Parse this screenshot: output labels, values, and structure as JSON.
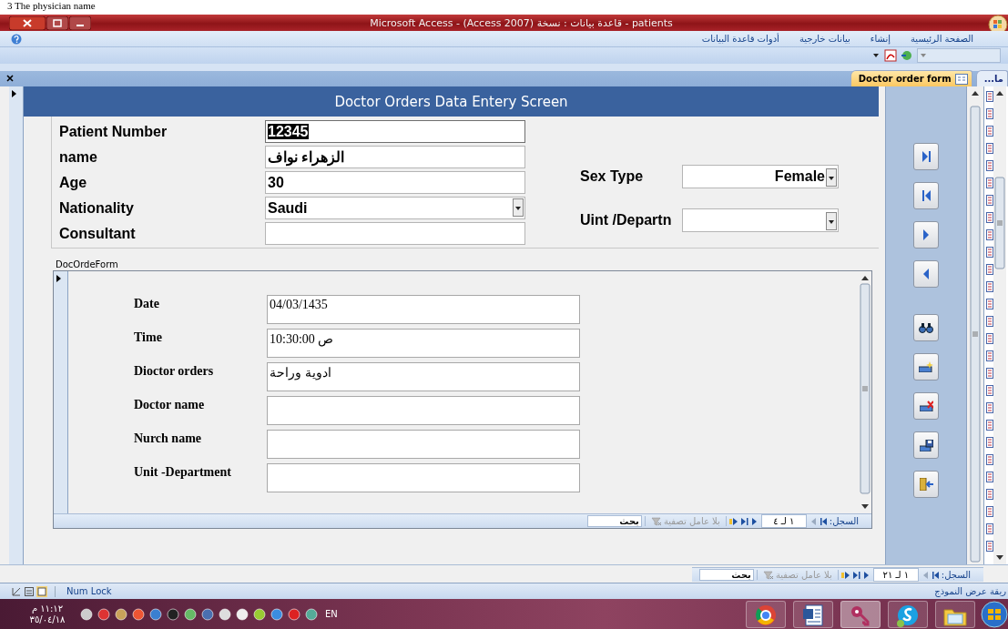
{
  "document_line": "3 The physician name",
  "window": {
    "title": "Microsoft Access - (Access 2007) قاعدة بيانات : نسخة - patients"
  },
  "ribbon": {
    "tabs": [
      {
        "label": "الصفحة الرئيسية"
      },
      {
        "label": "إنشاء"
      },
      {
        "label": "بيانات خارجية"
      },
      {
        "label": "أدوات قاعدة البيانات"
      }
    ]
  },
  "document_tabs": [
    {
      "label": "ما...",
      "selected": false
    },
    {
      "label": "Doctor order form",
      "selected": true
    }
  ],
  "main_form": {
    "header": "Doctor Orders  Data Entery Screen",
    "fields": [
      {
        "label": "Patient Number",
        "value": "12345",
        "kind": "text",
        "text_selected": true
      },
      {
        "label": "name",
        "value": "الزهراء نواف",
        "kind": "text",
        "text_selected": false
      },
      {
        "label": "Age",
        "value": "30",
        "kind": "text",
        "text_selected": false
      },
      {
        "label": "Nationality",
        "value": "Saudi",
        "kind": "combo",
        "text_selected": false
      },
      {
        "label": "Consultant",
        "kind": "text",
        "text_selected": false
      }
    ],
    "side_fields": [
      {
        "label": "Sex Type",
        "value": "Female",
        "kind": "combo"
      },
      {
        "label": "Uint /Departn",
        "kind": "combo"
      }
    ]
  },
  "subform": {
    "label": "DocOrdeForm",
    "fields": [
      {
        "label": "Date",
        "value": "04/03/1435"
      },
      {
        "label": "Time",
        "value": "ص 10:30:00"
      },
      {
        "label": "Dioctor orders",
        "value": "ادوية وراحة"
      },
      {
        "label": "Doctor name"
      },
      {
        "label": "Nurch name"
      },
      {
        "label": "Unit -Department"
      }
    ],
    "record_nav": {
      "label": "السجل:",
      "position": "١ لـ ٤",
      "filter": "بلا عامل تصفية",
      "search": {
        "placeholder": "بحث"
      }
    }
  },
  "nav_buttons": [
    {
      "kind": "last"
    },
    {
      "kind": "first"
    },
    {
      "kind": "next"
    },
    {
      "kind": "previous"
    },
    {
      "kind": "find"
    },
    {
      "kind": "new"
    },
    {
      "kind": "delete"
    },
    {
      "kind": "save"
    },
    {
      "kind": "exit"
    }
  ],
  "record_nav": {
    "label": "السجل:",
    "position": "١ لـ ٢١",
    "filter": "بلا عامل تصفية",
    "search": {
      "placeholder": "بحث"
    }
  },
  "status_bar": {
    "left": "Num Lock",
    "right": "ريقة عرض النموذج"
  },
  "taskbar": {
    "clock_time": "١١:١٢ م",
    "clock_date": "٣٥/٠٤/١٨",
    "language": "EN",
    "apps": [
      {
        "kind": "browser",
        "selected": false
      },
      {
        "kind": "word",
        "selected": false
      },
      {
        "kind": "access",
        "selected": true
      },
      {
        "kind": "chat",
        "selected": false
      },
      {
        "kind": "folder",
        "selected": false
      }
    ]
  }
}
